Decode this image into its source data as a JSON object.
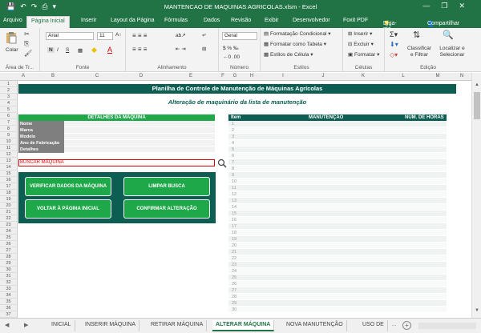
{
  "window": {
    "title": "MANTENCAO DE MAQUINAS AGRICOLAS.xlsm - Excel",
    "controls": [
      "—",
      "❐",
      "✕"
    ]
  },
  "ribbon_tabs": [
    "Arquivo",
    "Página Inicial",
    "Inserir",
    "Layout da Página",
    "Fórmulas",
    "Dados",
    "Revisão",
    "Exibir",
    "Desenvolvedor",
    "Foxit PDF"
  ],
  "tell_me": "Diga-me...",
  "share": "Compartilhar",
  "ribbon": {
    "clipboard": {
      "paste": "Colar",
      "label": "Área de Tr..."
    },
    "font": {
      "name": "Arial",
      "size": "11",
      "bold": "N",
      "italic": "I",
      "underline": "S",
      "label": "Fonte"
    },
    "alignment": {
      "label": "Alinhamento"
    },
    "number": {
      "format": "Geral",
      "label": "Número"
    },
    "styles": {
      "conditional": "Formatação Condicional",
      "table": "Formatar como Tabela",
      "cell": "Estilos de Célula",
      "label": "Estilos"
    },
    "cells": {
      "insert": "Inserir",
      "delete": "Excluir",
      "format": "Formatar",
      "label": "Células"
    },
    "editing": {
      "sort": "Classificar e Filtrar",
      "find": "Localizar e Selecionar",
      "label": "Edição"
    }
  },
  "columns": [
    "A",
    "B",
    "C",
    "D",
    "E",
    "F",
    "G",
    "H",
    "I",
    "J",
    "K",
    "L",
    "M",
    "N"
  ],
  "sheet": {
    "banner": "Planilha de Controle de Manutenção de Máquinas Agrícolas",
    "subtitle": "Alteração de maquinário da lista de manutenção",
    "details_header": "DETALHES DA MÁQUINA",
    "fields": [
      "Nome",
      "Marca",
      "Modelo",
      "Ano de Fabricação",
      "Detalhes"
    ],
    "search_label": "BUSCAR MÁQUINA",
    "buttons": {
      "verify": "VERIFICAR DADOS DA MÁQUINA",
      "clear": "LIMPAR BUSCA",
      "back": "VOLTAR À PÁGINA INICIAL",
      "confirm": "CONFIRMAR ALTERAÇÃO"
    },
    "table_headers": {
      "item": "Item",
      "maintenance": "MANUTENÇÃO",
      "hours": "NÚM. DE HORAS"
    },
    "item_numbers": [
      "1",
      "2",
      "3",
      "4",
      "5",
      "6",
      "7",
      "8",
      "9",
      "10",
      "11",
      "12",
      "13",
      "14",
      "15",
      "16",
      "17",
      "18",
      "19",
      "20",
      "21",
      "22",
      "23",
      "24",
      "25",
      "26",
      "27",
      "28",
      "29",
      "30"
    ]
  },
  "sheet_tabs": [
    "INICIAL",
    "INSERIR MÁQUINA",
    "RETIRAR MÁQUINA",
    "ALTERAR MÁQUINA",
    "NOVA MANUTENÇÃO",
    "USO DE"
  ],
  "active_sheet": "ALTERAR MÁQUINA",
  "accent_color": "#217346",
  "panel_color": "#0b5e51",
  "button_color": "#1fa84a"
}
